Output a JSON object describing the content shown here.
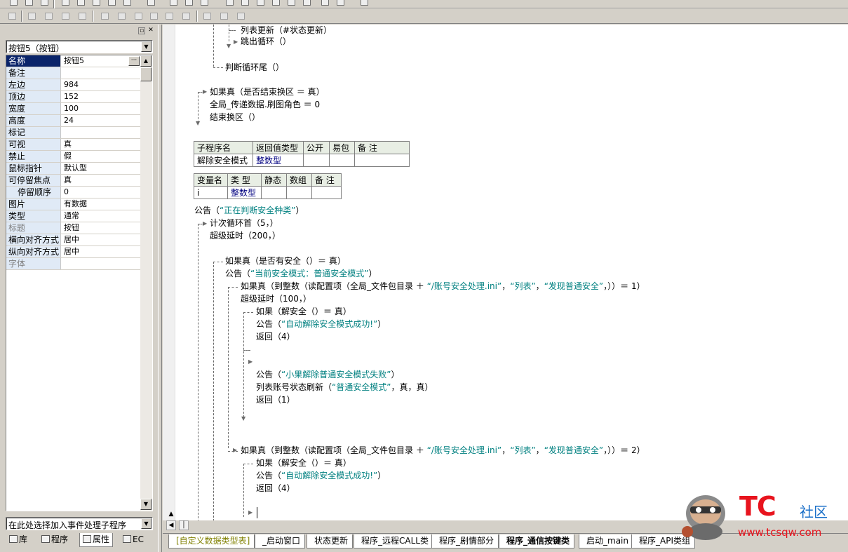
{
  "left_panel": {
    "object_selector": "按钮5（按钮）",
    "properties": [
      {
        "name": "名称",
        "value": "按钮5",
        "selected": true
      },
      {
        "name": "备注",
        "value": ""
      },
      {
        "name": "左边",
        "value": "984"
      },
      {
        "name": "顶边",
        "value": "152"
      },
      {
        "name": "宽度",
        "value": "100"
      },
      {
        "name": "高度",
        "value": "24"
      },
      {
        "name": "标记",
        "value": ""
      },
      {
        "name": "可视",
        "value": "真"
      },
      {
        "name": "禁止",
        "value": "假"
      },
      {
        "name": "鼠标指针",
        "value": "默认型"
      },
      {
        "name": "可停留焦点",
        "value": "真"
      },
      {
        "name": "停留顺序",
        "value": "0"
      },
      {
        "name": "图片",
        "value": "有数据"
      },
      {
        "name": "类型",
        "value": "通常"
      },
      {
        "name": "标题",
        "value": "按钮"
      },
      {
        "name": "横向对齐方式",
        "value": "居中"
      },
      {
        "name": "纵向对齐方式",
        "value": "居中"
      },
      {
        "name": "字体",
        "value": ""
      }
    ],
    "event_selector": "在此处选择加入事件处理子程序",
    "tabs": [
      "库",
      "程序",
      "属性",
      "EC"
    ]
  },
  "editor": {
    "lines_top": [
      "列表更新（#状态更新）",
      "跳出循环（）",
      "判断循环尾（）",
      "如果真（是否结束换区 ＝ 真）",
      "全局_传递数据.刷图角色 ＝ 0",
      "结束换区（）"
    ],
    "sub_table": {
      "headers": [
        "子程序名",
        "返回值类型",
        "公开",
        "易包",
        "备 注"
      ],
      "row": [
        "解除安全模式",
        "整数型",
        "",
        "",
        ""
      ]
    },
    "var_table": {
      "headers": [
        "变量名",
        "类 型",
        "静态",
        "数组",
        "备 注"
      ],
      "row": [
        "i",
        "整数型",
        "",
        "",
        ""
      ]
    },
    "code": {
      "l1": "公告（",
      "l1s": "“正在判断安全种类”",
      "l1e": "）",
      "l2": "计次循环首（5，）",
      "l3": "超级延时（200，）",
      "l4": "如果真（是否有安全（）＝ 真）",
      "l5": "公告（",
      "l5s": "“当前安全模式：普通安全模式”",
      "l5e": "）",
      "l6": "如果真（到整数（读配置项（全局_文件包目录 ＋ ",
      "l6s1": "“/账号安全处理.ini”",
      "l6m": "，",
      "l6s2": "“列表”",
      "l6m2": "，",
      "l6s3": "“发现普通安全”",
      "l6e": "，））＝ 1）",
      "l7": "超级延时（100，）",
      "l8": "如果（解安全（）＝ 真）",
      "l9": "公告（",
      "l9s": "“自动解除安全模式成功!”",
      "l9e": "）",
      "l10": "返回（4）",
      "l11": "公告（",
      "l11s": "“小果解除普通安全模式失败”",
      "l11e": "）",
      "l12": "列表账号状态刷新（",
      "l12s": "“普通安全模式”",
      "l12e": "，真，真）",
      "l13": "返回（1）",
      "l14": "如果真（到整数（读配置项（全局_文件包目录 ＋ ",
      "l14s1": "“/账号安全处理.ini”",
      "l14m": "，",
      "l14s2": "“列表”",
      "l14m2": "，",
      "l14s3": "“发现普通安全”",
      "l14e": "，））＝ 2）",
      "l15": "如果（解安全（）＝ 真）",
      "l16": "公告（",
      "l16s": "“自动解除安全模式成功!”",
      "l16e": "）",
      "l17": "返回（4）"
    }
  },
  "bottom_tabs": [
    "[自定义数据类型表]",
    "_启动窗口",
    "状态更新",
    "程序_远程CALL类",
    "程序_剧情部分",
    "程序_通信按键类",
    "启动_main",
    "程序_API类组"
  ],
  "active_tab": "程序_通信按键类",
  "watermark": {
    "brand": "TC",
    "brand2": "社区",
    "url": "www.tcsqw.com"
  },
  "colors": {
    "selection": "#0a246a",
    "string": "#008080",
    "logo_red": "#e8141e",
    "logo_blue": "#1a6fc8"
  }
}
